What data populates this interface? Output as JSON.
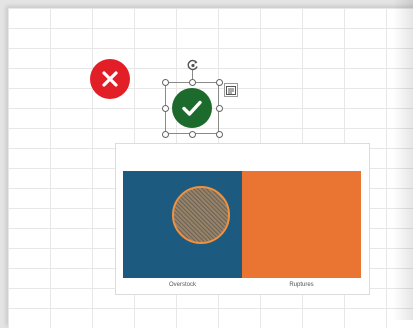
{
  "colors": {
    "cross_red": "#e21e26",
    "check_green": "#1d6b2c",
    "bar_blue": "#1c5a80",
    "bar_orange": "#ea7533"
  },
  "icons": {
    "cross": "close-icon",
    "check": "checkmark-icon",
    "rotate": "rotate-handle-icon",
    "layout": "layout-options-icon"
  },
  "chart": {
    "categories": [
      "Overstock",
      "Ruptures"
    ]
  }
}
